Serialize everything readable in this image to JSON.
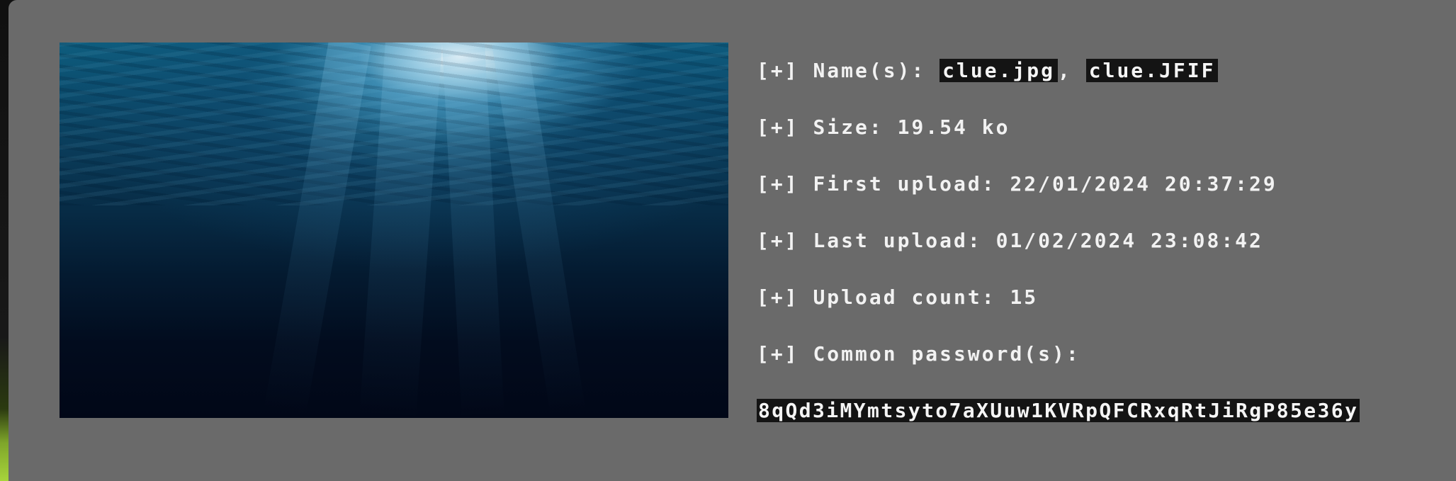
{
  "file_info": {
    "prefix": "[+]",
    "names_label": "Name(s):",
    "names": [
      "clue.jpg",
      "clue.JFIF"
    ],
    "names_separator": ",",
    "size_label": "Size:",
    "size_value": "19.54 ko",
    "first_upload_label": "First upload:",
    "first_upload_value": "22/01/2024 20:37:29",
    "last_upload_label": "Last upload:",
    "last_upload_value": "01/02/2024 23:08:42",
    "upload_count_label": "Upload count:",
    "upload_count_value": "15",
    "common_passwords_label": "Common password(s):",
    "common_passwords": [
      "8qQd3iMYmtsyto7aXUuw1KVRpQFCRxqRtJiRgP85e36y"
    ]
  },
  "colors": {
    "card_background": "#6a6a6a",
    "text": "#f2f2f2",
    "highlight_background": "#141414"
  }
}
